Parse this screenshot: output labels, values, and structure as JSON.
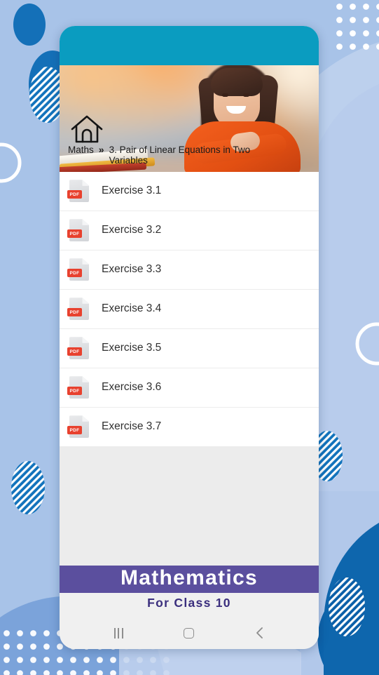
{
  "app": {
    "header_color": "#0a9cc0",
    "background_color": "#a8c3e8"
  },
  "hero": {
    "breadcrumb": {
      "home_icon": "home-icon",
      "root": "Maths",
      "separator": "»",
      "current": "3. Pair of Linear Equations in Two Variables"
    }
  },
  "list": {
    "icon": "pdf-file-icon",
    "badge_label": "PDF",
    "badge_color": "#e8412e",
    "items": [
      {
        "label": "Exercise 3.1"
      },
      {
        "label": "Exercise 3.2"
      },
      {
        "label": "Exercise 3.3"
      },
      {
        "label": "Exercise 3.4"
      },
      {
        "label": "Exercise 3.5"
      },
      {
        "label": "Exercise 3.6"
      },
      {
        "label": "Exercise 3.7"
      }
    ]
  },
  "brand": {
    "title": "Mathematics",
    "subtitle": "For Class 10",
    "bar_color": "#5b4f9e",
    "subtitle_color": "#3b2f7e"
  },
  "navbar": {
    "recents": "recents-icon",
    "home": "home-square-icon",
    "back": "back-chevron-icon"
  }
}
